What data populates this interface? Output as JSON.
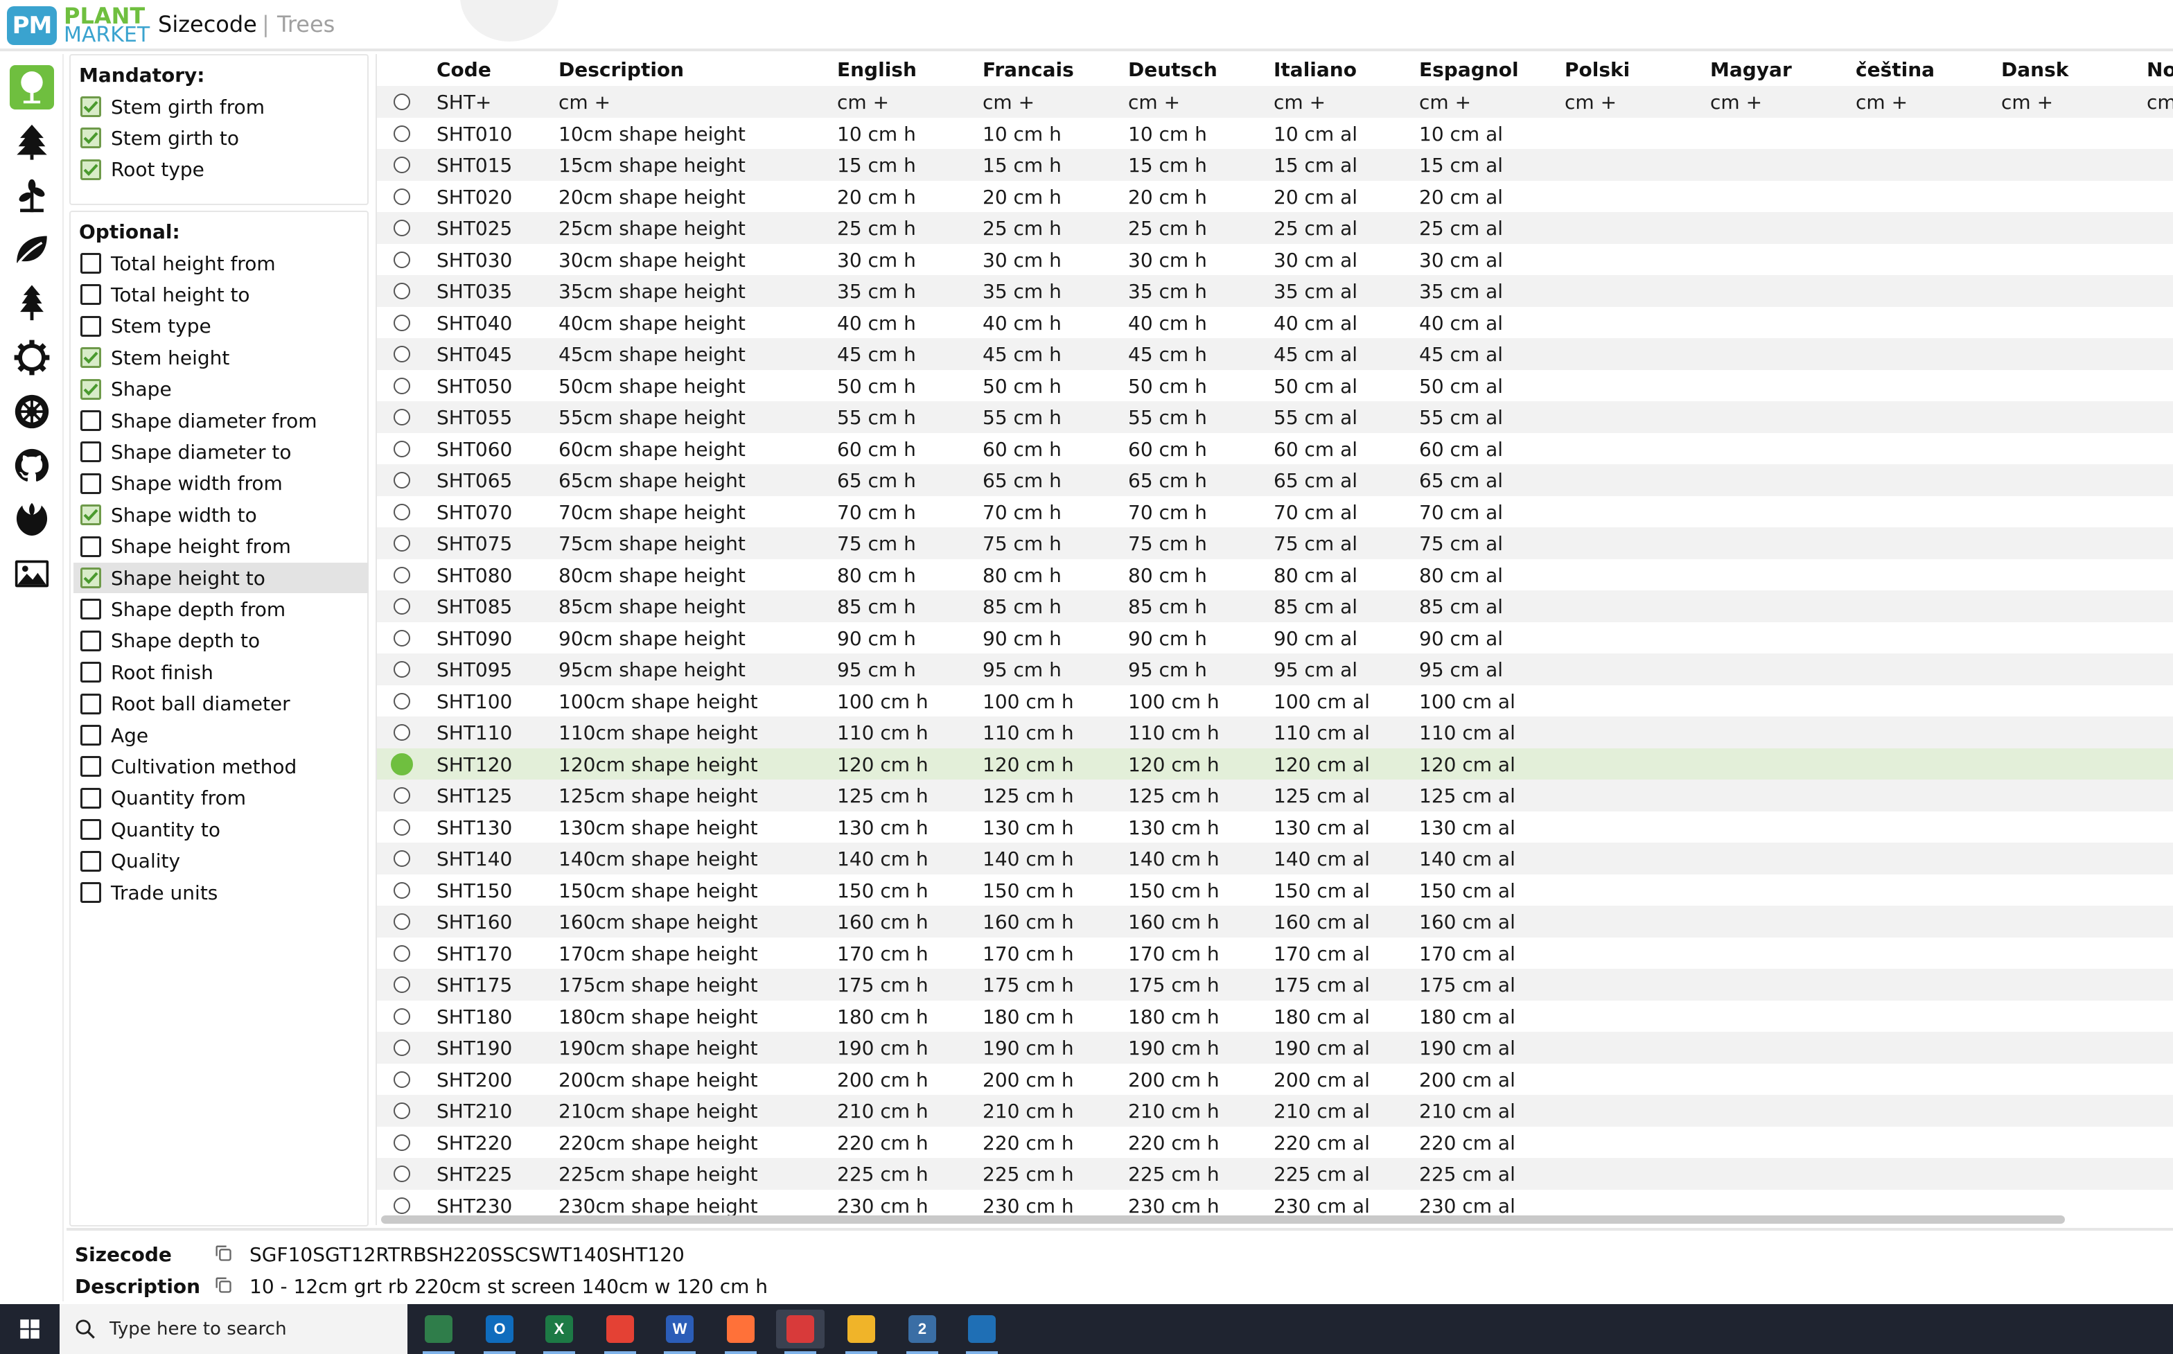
{
  "header": {
    "logo_abbr": "PM",
    "logo_word1": "PLANT",
    "logo_word2": "MARKET",
    "title": "Sizecode",
    "separator": "|",
    "subtitle": "Trees"
  },
  "rail": {
    "icons": [
      "tree-round-icon",
      "tree-conifer-icon",
      "plant-icon",
      "leaf-icon",
      "pine-icon",
      "settings-cog-icon",
      "galactic-empire-icon",
      "github-icon",
      "rebel-alliance-icon",
      "image-icon"
    ],
    "active_color": "#6fbf3f"
  },
  "mandatory": {
    "title": "Mandatory:",
    "items": [
      {
        "label": "Stem girth from",
        "checked": true
      },
      {
        "label": "Stem girth to",
        "checked": true
      },
      {
        "label": "Root type",
        "checked": true
      }
    ]
  },
  "optional": {
    "title": "Optional:",
    "items": [
      {
        "label": "Total height from",
        "checked": false
      },
      {
        "label": "Total height to",
        "checked": false
      },
      {
        "label": "Stem type",
        "checked": false
      },
      {
        "label": "Stem height",
        "checked": true
      },
      {
        "label": "Shape",
        "checked": true
      },
      {
        "label": "Shape diameter from",
        "checked": false
      },
      {
        "label": "Shape diameter to",
        "checked": false
      },
      {
        "label": "Shape width from",
        "checked": false
      },
      {
        "label": "Shape width to",
        "checked": true
      },
      {
        "label": "Shape height from",
        "checked": false
      },
      {
        "label": "Shape height to",
        "checked": true,
        "highlighted": true
      },
      {
        "label": "Shape depth from",
        "checked": false
      },
      {
        "label": "Shape depth to",
        "checked": false
      },
      {
        "label": "Root finish",
        "checked": false
      },
      {
        "label": "Root ball diameter",
        "checked": false
      },
      {
        "label": "Age",
        "checked": false
      },
      {
        "label": "Cultivation method",
        "checked": false
      },
      {
        "label": "Quantity from",
        "checked": false
      },
      {
        "label": "Quantity to",
        "checked": false
      },
      {
        "label": "Quality",
        "checked": false
      },
      {
        "label": "Trade units",
        "checked": false
      }
    ]
  },
  "table": {
    "columns": [
      "Code",
      "Description",
      "English",
      "Francais",
      "Deutsch",
      "Italiano",
      "Espagnol",
      "Polski",
      "Magyar",
      "čeština",
      "Dansk",
      "No"
    ],
    "rows": [
      {
        "code": "SHT+",
        "desc": "cm +",
        "en": "cm +",
        "fr": "cm +",
        "de": "cm +",
        "it": "cm +",
        "es": "cm +",
        "pl": "cm +",
        "hu": "cm +",
        "cs": "cm +",
        "da": "cm +",
        "no": "cm"
      },
      {
        "code": "SHT010",
        "desc": "10cm shape height",
        "en": "10 cm h",
        "fr": "10 cm h",
        "de": "10 cm h",
        "it": "10 cm al",
        "es": "10 cm al"
      },
      {
        "code": "SHT015",
        "desc": "15cm shape height",
        "en": "15 cm h",
        "fr": "15 cm h",
        "de": "15 cm h",
        "it": "15 cm al",
        "es": "15 cm al"
      },
      {
        "code": "SHT020",
        "desc": "20cm shape height",
        "en": "20 cm h",
        "fr": "20 cm h",
        "de": "20 cm h",
        "it": "20 cm al",
        "es": "20 cm al"
      },
      {
        "code": "SHT025",
        "desc": "25cm shape height",
        "en": "25 cm h",
        "fr": "25 cm h",
        "de": "25 cm h",
        "it": "25 cm al",
        "es": "25 cm al"
      },
      {
        "code": "SHT030",
        "desc": "30cm shape height",
        "en": "30 cm h",
        "fr": "30 cm h",
        "de": "30 cm h",
        "it": "30 cm al",
        "es": "30 cm al"
      },
      {
        "code": "SHT035",
        "desc": "35cm shape height",
        "en": "35 cm h",
        "fr": "35 cm h",
        "de": "35 cm h",
        "it": "35 cm al",
        "es": "35 cm al"
      },
      {
        "code": "SHT040",
        "desc": "40cm shape height",
        "en": "40 cm h",
        "fr": "40 cm h",
        "de": "40 cm h",
        "it": "40 cm al",
        "es": "40 cm al"
      },
      {
        "code": "SHT045",
        "desc": "45cm shape height",
        "en": "45 cm h",
        "fr": "45 cm h",
        "de": "45 cm h",
        "it": "45 cm al",
        "es": "45 cm al"
      },
      {
        "code": "SHT050",
        "desc": "50cm shape height",
        "en": "50 cm h",
        "fr": "50 cm h",
        "de": "50 cm h",
        "it": "50 cm al",
        "es": "50 cm al"
      },
      {
        "code": "SHT055",
        "desc": "55cm shape height",
        "en": "55 cm h",
        "fr": "55 cm h",
        "de": "55 cm h",
        "it": "55 cm al",
        "es": "55 cm al"
      },
      {
        "code": "SHT060",
        "desc": "60cm shape height",
        "en": "60 cm h",
        "fr": "60 cm h",
        "de": "60 cm h",
        "it": "60 cm al",
        "es": "60 cm al"
      },
      {
        "code": "SHT065",
        "desc": "65cm shape height",
        "en": "65 cm h",
        "fr": "65 cm h",
        "de": "65 cm h",
        "it": "65 cm al",
        "es": "65 cm al"
      },
      {
        "code": "SHT070",
        "desc": "70cm shape height",
        "en": "70 cm h",
        "fr": "70 cm h",
        "de": "70 cm h",
        "it": "70 cm al",
        "es": "70 cm al"
      },
      {
        "code": "SHT075",
        "desc": "75cm shape height",
        "en": "75 cm h",
        "fr": "75 cm h",
        "de": "75 cm h",
        "it": "75 cm al",
        "es": "75 cm al"
      },
      {
        "code": "SHT080",
        "desc": "80cm shape height",
        "en": "80 cm h",
        "fr": "80 cm h",
        "de": "80 cm h",
        "it": "80 cm al",
        "es": "80 cm al"
      },
      {
        "code": "SHT085",
        "desc": "85cm shape height",
        "en": "85 cm h",
        "fr": "85 cm h",
        "de": "85 cm h",
        "it": "85 cm al",
        "es": "85 cm al"
      },
      {
        "code": "SHT090",
        "desc": "90cm shape height",
        "en": "90 cm h",
        "fr": "90 cm h",
        "de": "90 cm h",
        "it": "90 cm al",
        "es": "90 cm al"
      },
      {
        "code": "SHT095",
        "desc": "95cm shape height",
        "en": "95 cm h",
        "fr": "95 cm h",
        "de": "95 cm h",
        "it": "95 cm al",
        "es": "95 cm al"
      },
      {
        "code": "SHT100",
        "desc": "100cm shape height",
        "en": "100 cm h",
        "fr": "100 cm h",
        "de": "100 cm h",
        "it": "100 cm al",
        "es": "100 cm al"
      },
      {
        "code": "SHT110",
        "desc": "110cm shape height",
        "en": "110 cm h",
        "fr": "110 cm h",
        "de": "110 cm h",
        "it": "110 cm al",
        "es": "110 cm al"
      },
      {
        "code": "SHT120",
        "desc": "120cm shape height",
        "en": "120 cm h",
        "fr": "120 cm h",
        "de": "120 cm h",
        "it": "120 cm al",
        "es": "120 cm al",
        "selected": true
      },
      {
        "code": "SHT125",
        "desc": "125cm shape height",
        "en": "125 cm h",
        "fr": "125 cm h",
        "de": "125 cm h",
        "it": "125 cm al",
        "es": "125 cm al"
      },
      {
        "code": "SHT130",
        "desc": "130cm shape height",
        "en": "130 cm h",
        "fr": "130 cm h",
        "de": "130 cm h",
        "it": "130 cm al",
        "es": "130 cm al"
      },
      {
        "code": "SHT140",
        "desc": "140cm shape height",
        "en": "140 cm h",
        "fr": "140 cm h",
        "de": "140 cm h",
        "it": "140 cm al",
        "es": "140 cm al"
      },
      {
        "code": "SHT150",
        "desc": "150cm shape height",
        "en": "150 cm h",
        "fr": "150 cm h",
        "de": "150 cm h",
        "it": "150 cm al",
        "es": "150 cm al"
      },
      {
        "code": "SHT160",
        "desc": "160cm shape height",
        "en": "160 cm h",
        "fr": "160 cm h",
        "de": "160 cm h",
        "it": "160 cm al",
        "es": "160 cm al"
      },
      {
        "code": "SHT170",
        "desc": "170cm shape height",
        "en": "170 cm h",
        "fr": "170 cm h",
        "de": "170 cm h",
        "it": "170 cm al",
        "es": "170 cm al"
      },
      {
        "code": "SHT175",
        "desc": "175cm shape height",
        "en": "175 cm h",
        "fr": "175 cm h",
        "de": "175 cm h",
        "it": "175 cm al",
        "es": "175 cm al"
      },
      {
        "code": "SHT180",
        "desc": "180cm shape height",
        "en": "180 cm h",
        "fr": "180 cm h",
        "de": "180 cm h",
        "it": "180 cm al",
        "es": "180 cm al"
      },
      {
        "code": "SHT190",
        "desc": "190cm shape height",
        "en": "190 cm h",
        "fr": "190 cm h",
        "de": "190 cm h",
        "it": "190 cm al",
        "es": "190 cm al"
      },
      {
        "code": "SHT200",
        "desc": "200cm shape height",
        "en": "200 cm h",
        "fr": "200 cm h",
        "de": "200 cm h",
        "it": "200 cm al",
        "es": "200 cm al"
      },
      {
        "code": "SHT210",
        "desc": "210cm shape height",
        "en": "210 cm h",
        "fr": "210 cm h",
        "de": "210 cm h",
        "it": "210 cm al",
        "es": "210 cm al"
      },
      {
        "code": "SHT220",
        "desc": "220cm shape height",
        "en": "220 cm h",
        "fr": "220 cm h",
        "de": "220 cm h",
        "it": "220 cm al",
        "es": "220 cm al"
      },
      {
        "code": "SHT225",
        "desc": "225cm shape height",
        "en": "225 cm h",
        "fr": "225 cm h",
        "de": "225 cm h",
        "it": "225 cm al",
        "es": "225 cm al"
      },
      {
        "code": "SHT230",
        "desc": "230cm shape height",
        "en": "230 cm h",
        "fr": "230 cm h",
        "de": "230 cm h",
        "it": "230 cm al",
        "es": "230 cm al"
      }
    ]
  },
  "footer": {
    "sizecode_label": "Sizecode",
    "sizecode_value": "SGF10SGT12RTRBSH220SSCSWT140SHT120",
    "description_label": "Description",
    "description_value": "10 - 12cm grt rb 220cm st screen 140cm w 120 cm h"
  },
  "taskbar": {
    "search_placeholder": "Type here to search",
    "apps": [
      {
        "name": "plant-market-app",
        "label": "",
        "color": "#2f7d4a"
      },
      {
        "name": "outlook-app",
        "label": "O",
        "color": "#0f6cbd"
      },
      {
        "name": "excel-app",
        "label": "X",
        "color": "#1d7a45"
      },
      {
        "name": "chrome-app",
        "label": "",
        "color": "#e44134"
      },
      {
        "name": "word-app",
        "label": "W",
        "color": "#2b5db8"
      },
      {
        "name": "firefox-app",
        "label": "",
        "color": "#ff7139"
      },
      {
        "name": "pin-app",
        "label": "",
        "color": "#d83a3a"
      },
      {
        "name": "file-explorer-app",
        "label": "",
        "color": "#f0b429"
      },
      {
        "name": "remote-app",
        "label": "2",
        "color": "#3a6ea5"
      },
      {
        "name": "defender-app",
        "label": "",
        "color": "#1f6fb5"
      }
    ]
  }
}
